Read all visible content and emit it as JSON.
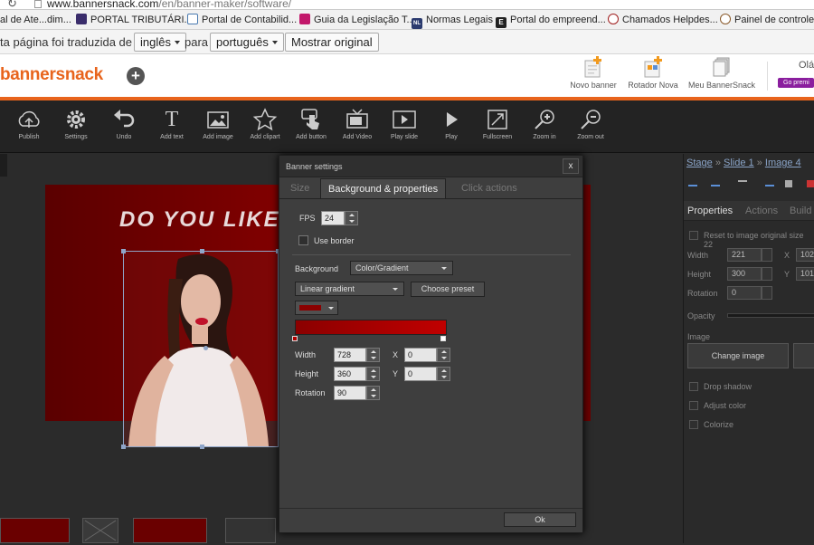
{
  "browser": {
    "url_host": "www.bannersnack.com",
    "url_path": "/en/banner-maker/software/",
    "bookmarks": [
      {
        "label": "al de Ate...dim...",
        "color": "#c33"
      },
      {
        "label": "PORTAL TRIBUTÁRI...",
        "color": "#3a2d6b"
      },
      {
        "label": "Portal de Contabilid...",
        "color": "#4a7ab0"
      },
      {
        "label": "Guia da Legislação T...",
        "color": "#c2186b"
      },
      {
        "label": "Normas Legais",
        "color": "#2b3a6e"
      },
      {
        "label": "Portal do empreend...",
        "color": "#444"
      },
      {
        "label": "Chamados Helpdes...",
        "color": "#a01e1e"
      },
      {
        "label": "Painel de controle",
        "color": "#8a5a2b"
      }
    ],
    "nl_badge": "NL",
    "e_badge": "E",
    "translate": {
      "prefix": "ta página foi traduzida de",
      "from": "inglês",
      "middle": "para",
      "to": "português",
      "show_original": "Mostrar original"
    }
  },
  "site": {
    "logo": "bannersnack",
    "nav": [
      "Novo banner",
      "Rotador Nova",
      "Meu BannerSnack"
    ],
    "hello": "Olá",
    "premium": "Go premi",
    "accent": "#e8641c"
  },
  "toolbar": {
    "tools": [
      {
        "name": "publish",
        "label": "Publish",
        "icon": "cloud-upload-icon"
      },
      {
        "name": "settings",
        "label": "Settings",
        "icon": "gear-icon"
      },
      {
        "name": "undo",
        "label": "Undo",
        "icon": "undo-icon"
      },
      {
        "name": "add-text",
        "label": "Add text",
        "icon": "text-icon"
      },
      {
        "name": "add-image",
        "label": "Add image",
        "icon": "image-icon"
      },
      {
        "name": "add-clipart",
        "label": "Add clipart",
        "icon": "star-icon"
      },
      {
        "name": "add-button",
        "label": "Add button",
        "icon": "hand-pointer-icon"
      },
      {
        "name": "add-video",
        "label": "Add Video",
        "icon": "tv-icon"
      },
      {
        "name": "play-slide",
        "label": "Play slide",
        "icon": "play-slide-icon"
      },
      {
        "name": "play",
        "label": "Play",
        "icon": "play-icon"
      },
      {
        "name": "fullscreen",
        "label": "Fullscreen",
        "icon": "fullscreen-icon"
      },
      {
        "name": "zoom-in",
        "label": "Zoom in",
        "icon": "zoom-in-icon"
      },
      {
        "name": "zoom-out",
        "label": "Zoom out",
        "icon": "zoom-out-icon"
      }
    ]
  },
  "canvas": {
    "headline": "DO YOU LIKE",
    "banner_color": "#8b0000"
  },
  "right_panel": {
    "crumb": [
      "Stage",
      "Slide 1",
      "Image 4"
    ],
    "crumb_sep": "»",
    "tabs": [
      "Properties",
      "Actions",
      "Build"
    ],
    "reset": "Reset to image original size 22",
    "width_label": "Width",
    "width": "221",
    "x_label": "X",
    "x": "102",
    "height_label": "Height",
    "height": "300",
    "y_label": "Y",
    "y": "101",
    "rotation_label": "Rotation",
    "rotation": "0",
    "opacity_label": "Opacity",
    "image_label": "Image",
    "change_image": "Change image",
    "drop_shadow": "Drop shadow",
    "adjust_color": "Adjust color",
    "colorize": "Colorize"
  },
  "dialog": {
    "title": "Banner settings",
    "close": "x",
    "tabs": [
      "Size",
      "Background & properties",
      "Click actions"
    ],
    "fps_label": "FPS",
    "fps": "24",
    "use_border": "Use border",
    "background_label": "Background",
    "background_type": "Color/Gradient",
    "gradient_type": "Linear gradient",
    "choose_preset": "Choose preset",
    "gradient_from": "#8b0000",
    "gradient_to": "#c00000",
    "width_label": "Width",
    "width": "728",
    "x_label": "X",
    "x": "0",
    "height_label": "Height",
    "height": "360",
    "y_label": "Y",
    "y": "0",
    "rotation_label": "Rotation",
    "rotation": "90",
    "ok": "Ok"
  }
}
